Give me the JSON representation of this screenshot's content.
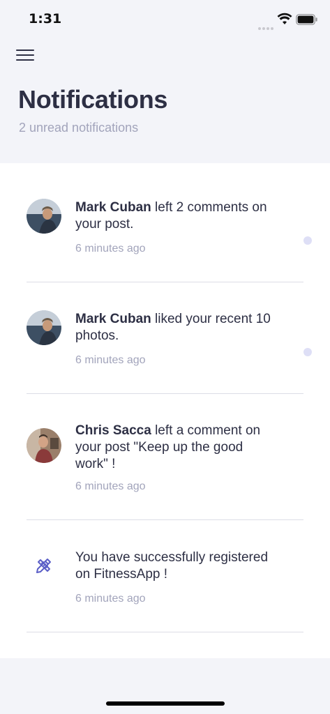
{
  "status_bar": {
    "time": "1:31"
  },
  "header": {
    "title": "Notifications",
    "subtitle": "2 unread notifications"
  },
  "notifications": [
    {
      "name": "Mark Cuban",
      "message_line1": " left 2 comments on",
      "message_line2": "your post.",
      "time": "6 minutes ago",
      "unread": true,
      "avatar": "person-photo"
    },
    {
      "name": "Mark Cuban",
      "message_line1": " liked your recent 10",
      "message_line2": "photos.",
      "time": "6 minutes ago",
      "unread": true,
      "avatar": "person-photo"
    },
    {
      "name": "Chris Sacca",
      "message_line1": " left a comment on",
      "message_line2": "your post \"Keep up the good",
      "message_line3": "work\" !",
      "time": "6 minutes ago",
      "unread": false,
      "avatar": "person-photo"
    },
    {
      "message_line1": " You have successfully registered",
      "message_line2": "on FitnessApp !",
      "time": "6 minutes ago",
      "unread": false,
      "icon": "pencil-ruler-icon"
    }
  ],
  "colors": {
    "background": "#f3f4f9",
    "card": "#ffffff",
    "title": "#2d2f44",
    "muted": "#a2a4bb",
    "unread_dot": "#dedff6",
    "accent": "#5b5fc7"
  }
}
